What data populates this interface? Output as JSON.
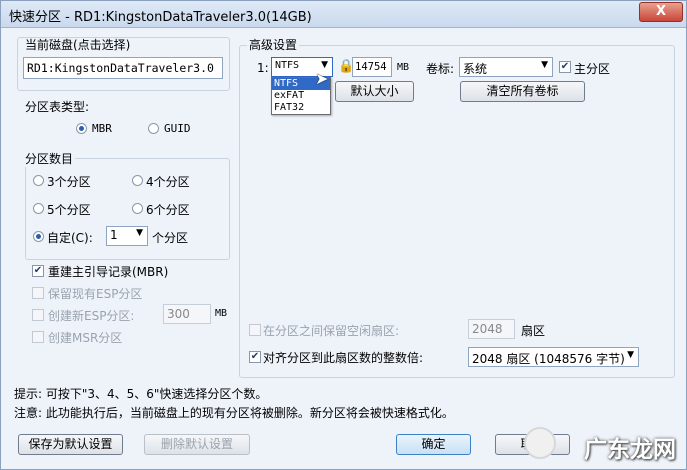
{
  "window": {
    "title": "快速分区 - RD1:KingstonDataTraveler3.0(14GB)",
    "close_label": "X"
  },
  "disk": {
    "label": "当前磁盘(点击选择)",
    "value": "RD1:KingstonDataTraveler3.0"
  },
  "table_type": {
    "label": "分区表类型:",
    "options": [
      "MBR",
      "GUID"
    ],
    "selected": "MBR"
  },
  "partition_count": {
    "label": "分区数目",
    "options": [
      "3个分区",
      "4个分区",
      "5个分区",
      "6个分区"
    ],
    "custom_label": "自定(C):",
    "custom_value": "1",
    "custom_suffix": "个分区"
  },
  "options": {
    "rebuild_mbr": "重建主引导记录(MBR)",
    "keep_esp": "保留现有ESP分区",
    "create_esp": "创建新ESP分区:",
    "esp_size": "300",
    "esp_unit": "MB",
    "create_msr": "创建MSR分区"
  },
  "advanced": {
    "label": "高级设置",
    "row_index": "1:",
    "fs_value": "NTFS",
    "fs_options": [
      "NTFS",
      "exFAT",
      "FAT32"
    ],
    "size_value": "14754",
    "size_unit": "MB",
    "volume_label": "卷标:",
    "volume_value": "系统",
    "primary_label": "主分区",
    "default_size_button": "默认大小",
    "clear_labels_button": "清空所有卷标"
  },
  "reserve": {
    "label": "在分区之间保留空闲扇区:",
    "value": "2048",
    "unit": "扇区"
  },
  "align": {
    "label": "对齐分区到此扇区数的整数倍:",
    "value": "2048 扇区 (1048576 字节)"
  },
  "notes": {
    "hint": "提示: 可按下\"3、4、5、6\"快速选择分区个数。",
    "warning": "注意: 此功能执行后，当前磁盘上的现有分区将被删除。新分区将会被快速格式化。"
  },
  "buttons": {
    "save_default": "保存为默认设置",
    "delete_default": "删除默认设置",
    "ok": "确定",
    "cancel": "取消"
  },
  "watermark": {
    "text": "广东龙网"
  }
}
